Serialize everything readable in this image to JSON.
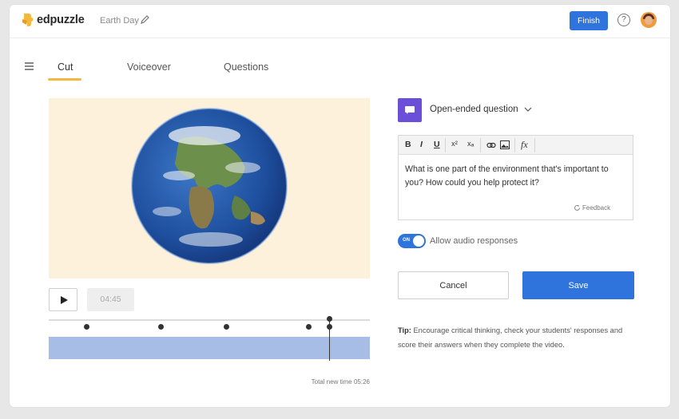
{
  "header": {
    "brand": "edpuzzle",
    "project_title": "Earth Day",
    "finish_label": "Finish",
    "help_symbol": "?"
  },
  "tabs": [
    {
      "label": "Cut",
      "active": true
    },
    {
      "label": "Voiceover",
      "active": false
    },
    {
      "label": "Questions",
      "active": false
    }
  ],
  "player": {
    "time": "04:45",
    "total_label": "Total new time 05:26"
  },
  "question": {
    "type_label": "Open-ended question",
    "toolbar": [
      "B",
      "I",
      "U",
      "x²",
      "xₐ",
      "link",
      "image",
      "fx"
    ],
    "text": "What is one part of the environment that's important to you? How could you help protect it?",
    "feedback_label": "Feedback",
    "toggle_text": "ON",
    "audio_label": "Allow audio responses",
    "cancel_label": "Cancel",
    "save_label": "Save",
    "tip_prefix": "Tip:",
    "tip_text": "Encourage critical thinking, check your students' responses and score their answers when they complete the video."
  },
  "colors": {
    "accent_blue": "#2f73dd",
    "tab_underline": "#f3b93c",
    "question_icon": "#6b4fd8",
    "timeline_fill": "#a7bde6"
  },
  "icons": [
    "edpuzzle-logo-icon",
    "pencil-icon",
    "help-icon",
    "avatar",
    "menu-icon",
    "play-icon",
    "chat-bubble-icon",
    "chevron-down-icon",
    "refresh-icon"
  ]
}
